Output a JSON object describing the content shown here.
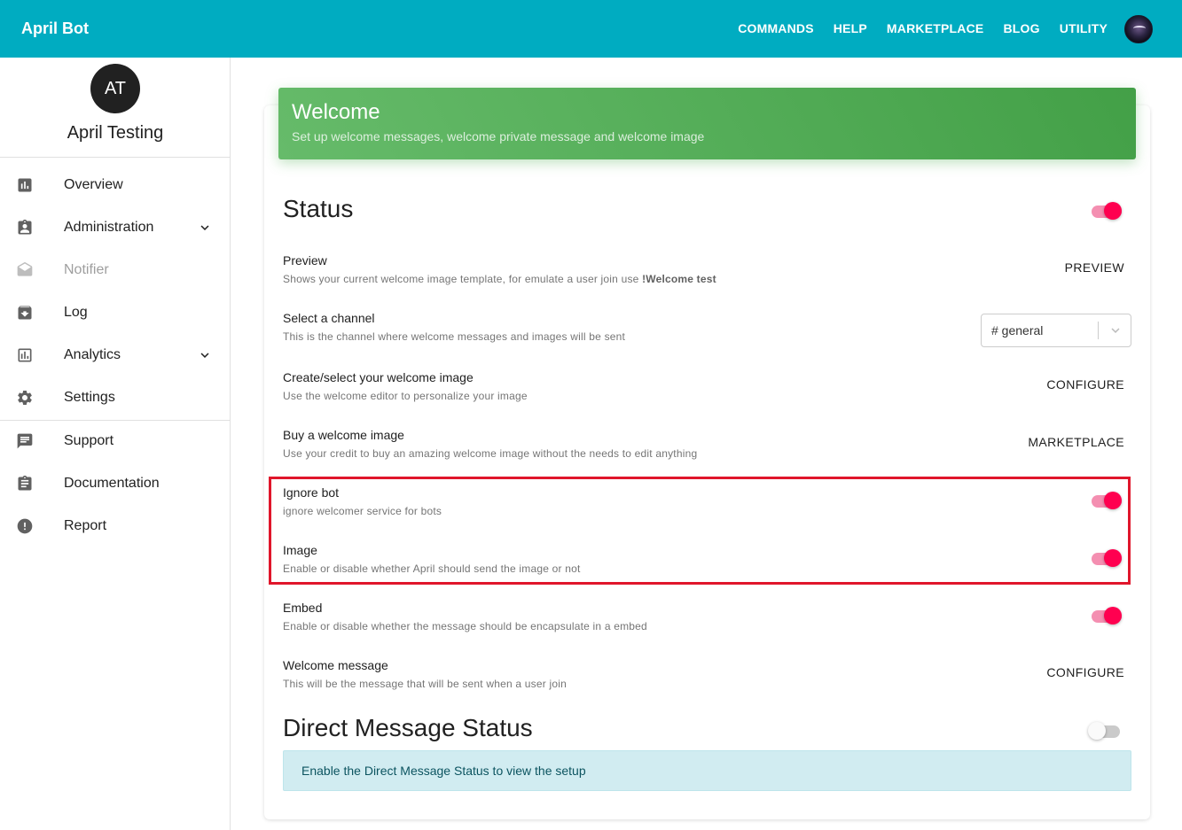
{
  "app": {
    "brand": "April Bot"
  },
  "topnav": {
    "items": [
      {
        "label": "COMMANDS"
      },
      {
        "label": "HELP"
      },
      {
        "label": "MARKETPLACE"
      },
      {
        "label": "BLOG"
      },
      {
        "label": "UTILITY"
      }
    ]
  },
  "sidebar": {
    "avatar_initials": "AT",
    "server_name": "April Testing",
    "items": [
      {
        "label": "Overview",
        "icon": "bar-chart-icon",
        "disabled": false,
        "expandable": false
      },
      {
        "label": "Administration",
        "icon": "badge-icon",
        "disabled": false,
        "expandable": true
      },
      {
        "label": "Notifier",
        "icon": "envelope-open-icon",
        "disabled": true,
        "expandable": false
      },
      {
        "label": "Log",
        "icon": "archive-icon",
        "disabled": false,
        "expandable": false
      },
      {
        "label": "Analytics",
        "icon": "analytics-icon",
        "disabled": false,
        "expandable": true
      },
      {
        "label": "Settings",
        "icon": "gear-icon",
        "disabled": false,
        "expandable": false
      },
      {
        "label": "Support",
        "icon": "chat-icon",
        "disabled": false,
        "expandable": false
      },
      {
        "label": "Documentation",
        "icon": "clipboard-icon",
        "disabled": false,
        "expandable": false
      },
      {
        "label": "Report",
        "icon": "alert-circle-icon",
        "disabled": false,
        "expandable": false
      }
    ]
  },
  "header": {
    "title": "Welcome",
    "subtitle": "Set up welcome messages, welcome private message and welcome image"
  },
  "status": {
    "title": "Status",
    "enabled": true,
    "rows": {
      "preview": {
        "title": "Preview",
        "desc": "Shows your current welcome image template, for emulate a user join use ",
        "desc_cmd": "!Welcome test",
        "action": "PREVIEW"
      },
      "channel": {
        "title": "Select a channel",
        "desc": "This is the channel where welcome messages and images will be sent",
        "selected": "# general"
      },
      "image_editor": {
        "title": "Create/select your welcome image",
        "desc": "Use the welcome editor to personalize your image",
        "action": "CONFIGURE"
      },
      "buy_image": {
        "title": "Buy a welcome image",
        "desc": "Use your credit to buy an amazing welcome image without the needs to edit anything",
        "action": "MARKETPLACE"
      },
      "ignore_bot": {
        "title": "Ignore bot",
        "desc": "ignore welcomer service for bots",
        "enabled": true
      },
      "image": {
        "title": "Image",
        "desc": "Enable or disable whether April should send the image or not",
        "enabled": true
      },
      "embed": {
        "title": "Embed",
        "desc": "Enable or disable whether the message should be encapsulate in a embed",
        "enabled": true
      },
      "welcome_message": {
        "title": "Welcome message",
        "desc": "This will be the message that will be sent when a user join",
        "action": "CONFIGURE"
      }
    }
  },
  "dm_status": {
    "title": "Direct Message Status",
    "enabled": false,
    "info": "Enable the Direct Message Status to view the setup"
  },
  "colors": {
    "topbar": "#00acc1",
    "header_gradient_start": "#66bb6a",
    "header_gradient_end": "#43a047",
    "toggle_on": "#ff0050",
    "highlight": "#e0162b"
  }
}
